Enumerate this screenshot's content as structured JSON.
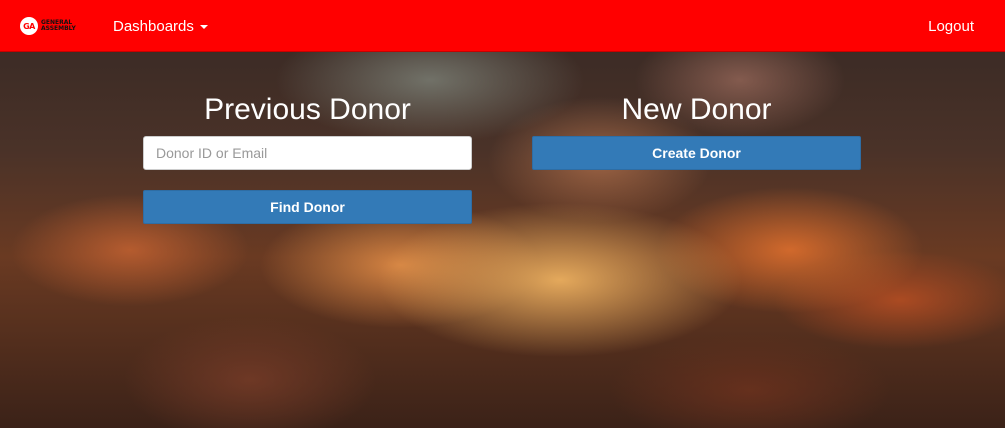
{
  "navbar": {
    "logo": {
      "badge": "GA",
      "line1": "General",
      "line2": "Assembly"
    },
    "dashboards_label": "Dashboards",
    "logout_label": "Logout",
    "brand_color": "#ff0000"
  },
  "previous_donor": {
    "heading": "Previous Donor",
    "search_placeholder": "Donor ID or Email",
    "search_value": "",
    "find_button_label": "Find Donor"
  },
  "new_donor": {
    "heading": "New Donor",
    "create_button_label": "Create Donor"
  },
  "colors": {
    "button_primary": "#337ab7"
  }
}
